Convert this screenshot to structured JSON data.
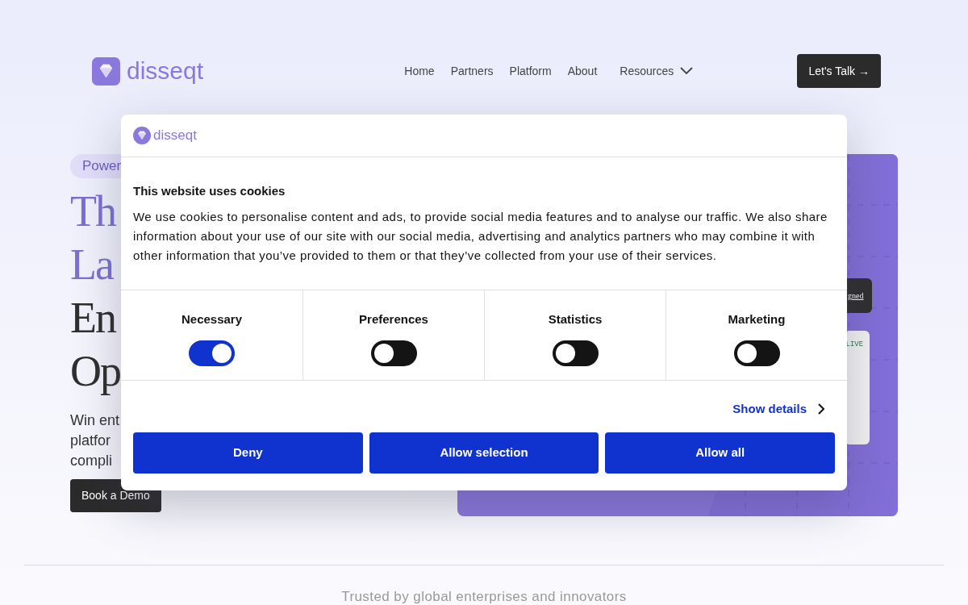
{
  "header": {
    "logo": "disseqt",
    "nav": [
      {
        "label": "Home",
        "dropdown": false
      },
      {
        "label": "Partners",
        "dropdown": false
      },
      {
        "label": "Platform",
        "dropdown": false
      },
      {
        "label": "About",
        "dropdown": false
      },
      {
        "label": "Resources",
        "dropdown": true
      }
    ],
    "cta": "Let's Talk →"
  },
  "hero": {
    "badge": "Power",
    "heading_lines": [
      {
        "text": "Th",
        "accent": true
      },
      {
        "text": "La",
        "accent": true
      },
      {
        "text": "En",
        "accent": false
      },
      {
        "text": "Op",
        "accent": false
      }
    ],
    "subtitle_lines": [
      "Win ent",
      "platfor",
      "compli"
    ],
    "button": "Book a Demo",
    "preview": {
      "chip": "gned",
      "status": "LIVE"
    }
  },
  "trusted": "Trusted by global enterprises and innovators",
  "cookie_dialog": {
    "logo": "disseqt",
    "title": "This website uses cookies",
    "body": "We use cookies to personalise content and ads, to provide social media features and to analyse our traffic. We also share information about your use of our site with our social media, advertising and analytics partners who may combine it with other information that you’ve provided to them or that they’ve collected from your use of their services.",
    "categories": [
      {
        "label": "Necessary",
        "on": true
      },
      {
        "label": "Preferences",
        "on": false
      },
      {
        "label": "Statistics",
        "on": false
      },
      {
        "label": "Marketing",
        "on": false
      }
    ],
    "details_link": "Show details",
    "buttons": [
      "Deny",
      "Allow selection",
      "Allow all"
    ]
  }
}
